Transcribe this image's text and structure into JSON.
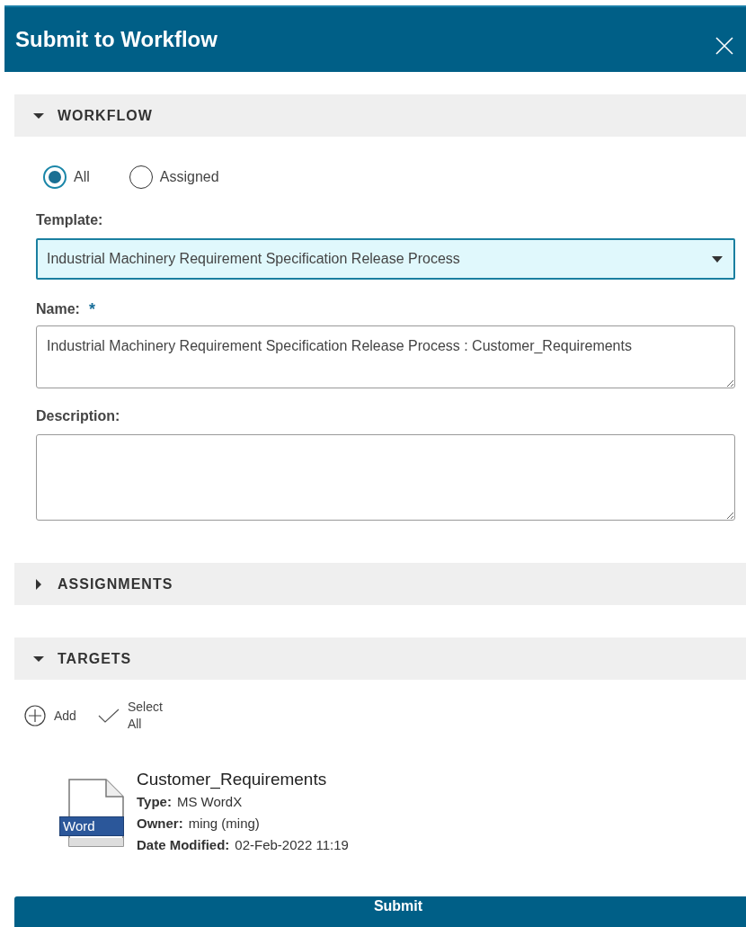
{
  "dialog": {
    "title": "Submit to Workflow"
  },
  "sections": [
    {
      "title": "WORKFLOW",
      "expanded": true
    },
    {
      "title": "ASSIGNMENTS",
      "expanded": false
    },
    {
      "title": "TARGETS",
      "expanded": true
    }
  ],
  "workflow": {
    "scope_options": [
      {
        "label": "All",
        "selected": true
      },
      {
        "label": "Assigned",
        "selected": false
      }
    ],
    "template": {
      "label": "Template:",
      "value": "Industrial Machinery Requirement Specification Release Process"
    },
    "name": {
      "label": "Name:",
      "required_mark": "*",
      "value": "Industrial Machinery Requirement Specification Release Process : Customer_Requirements"
    },
    "description": {
      "label": "Description:"
    }
  },
  "targets": {
    "toolbar": [
      {
        "kind": "add",
        "label": "Add"
      },
      {
        "kind": "select_all",
        "label": "Select All"
      }
    ],
    "items": [
      {
        "name": "Customer_Requirements",
        "badge": "Word",
        "fields": [
          {
            "label": "Type:",
            "value": "MS WordX"
          },
          {
            "label": "Owner:",
            "value": "ming (ming)"
          },
          {
            "label": "Date Modified:",
            "value": "02-Feb-2022 11:19"
          }
        ]
      }
    ]
  },
  "submit_button": "Submit"
}
